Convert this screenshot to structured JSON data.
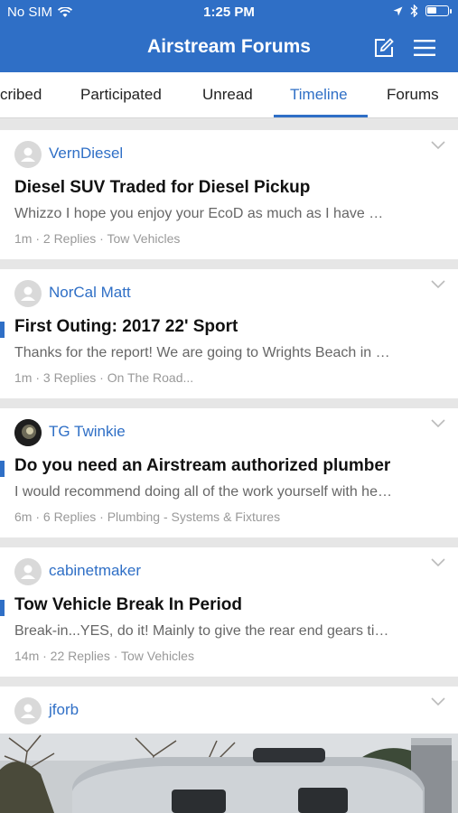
{
  "status_bar": {
    "carrier": "No SIM",
    "time": "1:25 PM"
  },
  "header": {
    "title": "Airstream Forums"
  },
  "tabs": [
    {
      "label": "cribed"
    },
    {
      "label": "Participated"
    },
    {
      "label": "Unread"
    },
    {
      "label": "Timeline"
    },
    {
      "label": "Forums"
    }
  ],
  "active_tab": "Timeline",
  "colors": {
    "brand": "#2f6fc6"
  },
  "threads": [
    {
      "author": "VernDiesel",
      "title": "Diesel SUV Traded for Diesel Pickup",
      "excerpt": "Whizzo I hope you enjoy your EcoD as much as I have …",
      "meta": "1m · 2 Replies · Tow Vehicles",
      "unread": false
    },
    {
      "author": "NorCal Matt",
      "title": "First Outing: 2017 22' Sport",
      "excerpt": "Thanks for the report! We are going to Wrights Beach in …",
      "meta": "1m · 3 Replies · On The Road...",
      "unread": true
    },
    {
      "author": "TG Twinkie",
      "title": "Do you need an Airstream authorized plumber",
      "excerpt": "I would recommend doing all of the work yourself with he…",
      "meta": "6m · 6 Replies · Plumbing - Systems & Fixtures",
      "unread": true
    },
    {
      "author": "cabinetmaker",
      "title": "Tow Vehicle Break In Period",
      "excerpt": "Break-in...YES, do it! Mainly to give the rear end gears ti…",
      "meta": "14m · 22 Replies · Tow Vehicles",
      "unread": true
    },
    {
      "author": "jforb"
    }
  ]
}
